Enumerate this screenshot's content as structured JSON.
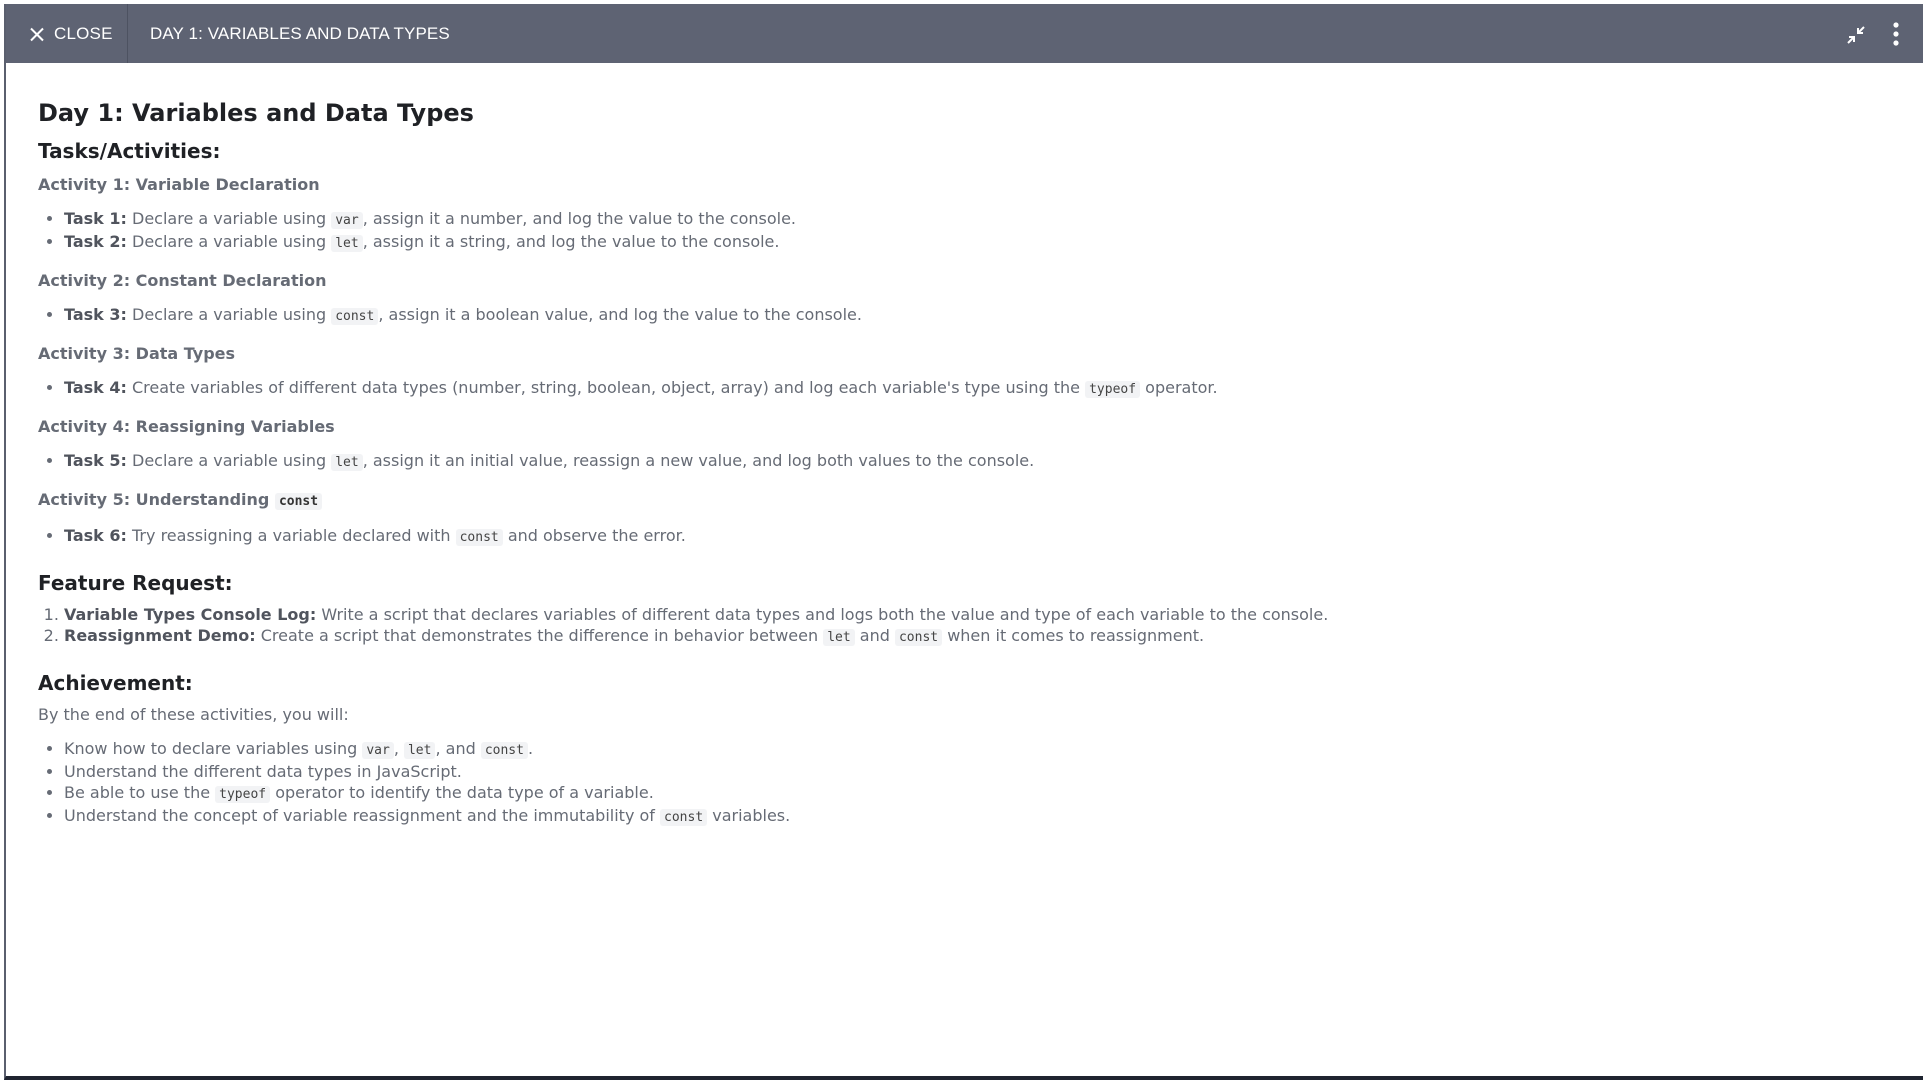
{
  "header": {
    "close_label": "CLOSE",
    "title": "DAY 1: VARIABLES AND DATA TYPES"
  },
  "doc": {
    "h1": "Day 1: Variables and Data Types",
    "tasks_heading": "Tasks/Activities:",
    "act1": {
      "heading": "Activity 1: Variable Declaration",
      "t1_label": "Task 1:",
      "t1_a": " Declare a variable using ",
      "t1_code": "var",
      "t1_b": ", assign it a number, and log the value to the console.",
      "t2_label": "Task 2:",
      "t2_a": " Declare a variable using ",
      "t2_code": "let",
      "t2_b": ", assign it a string, and log the value to the console."
    },
    "act2": {
      "heading": "Activity 2: Constant Declaration",
      "t3_label": "Task 3:",
      "t3_a": " Declare a variable using ",
      "t3_code": "const",
      "t3_b": ", assign it a boolean value, and log the value to the console."
    },
    "act3": {
      "heading": "Activity 3: Data Types",
      "t4_label": "Task 4:",
      "t4_a": " Create variables of different data types (number, string, boolean, object, array) and log each variable's type using the ",
      "t4_code": "typeof",
      "t4_b": " operator."
    },
    "act4": {
      "heading": "Activity 4: Reassigning Variables",
      "t5_label": "Task 5:",
      "t5_a": " Declare a variable using ",
      "t5_code": "let",
      "t5_b": ", assign it an initial value, reassign a new value, and log both values to the console."
    },
    "act5": {
      "heading": "Activity 5: Understanding ",
      "heading_code": "const",
      "t6_label": "Task 6:",
      "t6_a": " Try reassigning a variable declared with ",
      "t6_code": "const",
      "t6_b": " and observe the error."
    },
    "feature_heading": "Feature Request:",
    "feature": {
      "f1_label": "Variable Types Console Log:",
      "f1_text": " Write a script that declares variables of different data types and logs both the value and type of each variable to the console.",
      "f2_label": "Reassignment Demo:",
      "f2_a": " Create a script that demonstrates the difference in behavior between ",
      "f2_code1": "let",
      "f2_mid": " and ",
      "f2_code2": "const",
      "f2_b": " when it comes to reassignment."
    },
    "achievement_heading": "Achievement:",
    "achievement": {
      "intro": "By the end of these activities, you will:",
      "a1_a": "Know how to declare variables using ",
      "a1_c1": "var",
      "a1_s1": ", ",
      "a1_c2": "let",
      "a1_s2": ", and ",
      "a1_c3": "const",
      "a1_end": ".",
      "a2": "Understand the different data types in JavaScript.",
      "a3_a": "Be able to use the ",
      "a3_code": "typeof",
      "a3_b": " operator to identify the data type of a variable.",
      "a4_a": "Understand the concept of variable reassignment and the immutability of ",
      "a4_code": "const",
      "a4_b": " variables."
    }
  }
}
